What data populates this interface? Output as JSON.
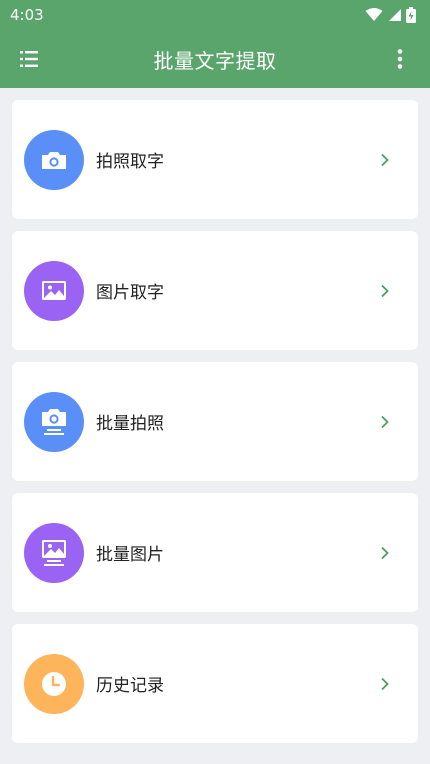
{
  "status_bar": {
    "time": "4:03"
  },
  "app_bar": {
    "title": "批量文字提取",
    "menu_icon": "list-icon",
    "more_icon": "more-vertical-icon"
  },
  "colors": {
    "primary": "#5aa56b",
    "blue": "#5b8ff8",
    "purple": "#9a63f3",
    "orange": "#fdb45a",
    "chevron": "#4c9e67"
  },
  "menu": {
    "items": [
      {
        "label": "拍照取字",
        "icon": "camera-icon"
      },
      {
        "label": "图片取字",
        "icon": "image-icon"
      },
      {
        "label": "批量拍照",
        "icon": "batch-camera-icon"
      },
      {
        "label": "批量图片",
        "icon": "batch-image-icon"
      },
      {
        "label": "历史记录",
        "icon": "clock-icon"
      }
    ]
  }
}
